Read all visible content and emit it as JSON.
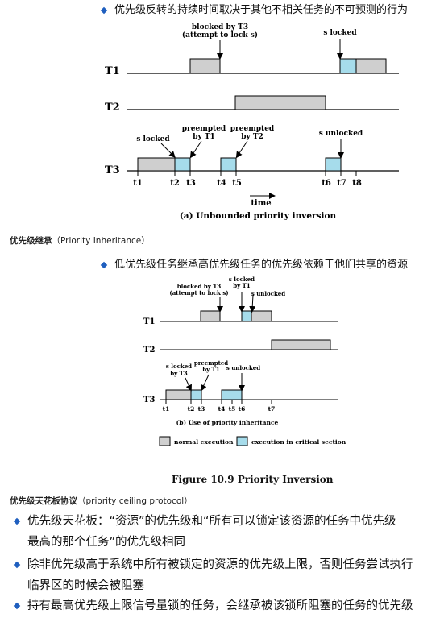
{
  "top_bullet": "优先级反转的持续时间取决于其他不相关任务的不可预测的行为",
  "diagram_a": {
    "rows": [
      "T1",
      "T2",
      "T3"
    ],
    "ann_blocked": [
      "blocked by T3",
      "(attempt to lock s)"
    ],
    "ann_s_locked_t1": "s locked",
    "ann_s_locked_t3": "s locked",
    "ann_preempted_t1": [
      "preempted",
      "by T1"
    ],
    "ann_preempted_t2": [
      "preempted",
      "by T2"
    ],
    "ann_s_unlocked": "s unlocked",
    "ticks": [
      "t1",
      "t2",
      "t3",
      "t4",
      "t5",
      "t6",
      "t7",
      "t8"
    ],
    "time_label": "time",
    "caption": "(a) Unbounded priority inversion"
  },
  "section_inherit": {
    "title": "优先级继承",
    "paren": "（Priority Inheritance）"
  },
  "inherit_bullet": "低优先级任务继承高优先级任务的优先级依赖于他们共享的资源",
  "diagram_b": {
    "rows": [
      "T1",
      "T2",
      "T3"
    ],
    "ann_blocked": [
      "blocked by T3",
      "(attempt to lock s)"
    ],
    "ann_s_locked_by_t1": [
      "s locked",
      "by T1"
    ],
    "ann_s_unlocked_top": "s unlocked",
    "ann_s_locked_by_t3": [
      "s locked",
      "by T3"
    ],
    "ann_preempted": [
      "preempted",
      "by T1"
    ],
    "ann_s_unlocked_bottom": "s unlocked",
    "ticks": [
      "t1",
      "t2",
      "t3",
      "t4",
      "t5",
      "t6",
      "t7"
    ],
    "caption": "(b) Use of priority inheritance",
    "legend": [
      "normal execution",
      "execution in critical section"
    ]
  },
  "figure_caption": "Figure 10.9    Priority Inversion",
  "section_ceiling": {
    "title": "优先级天花板协议",
    "paren": "（priority ceiling protocol）"
  },
  "ceiling_bullets": [
    [
      "优先级天花板：“资源”的优先级和“所有可以锁定该资源的任务中优先级",
      "最高的那个任务”的优先级相同"
    ],
    [
      "除非优先级高于系统中所有被锁定的资源的优先级上限，否则任务尝试执行",
      "临界区的时候会被阻塞"
    ],
    [
      "持有最高优先级上限信号量锁的任务，会继承被该锁所阻塞的任务的优先级"
    ]
  ],
  "colors": {
    "normal": "#cfcfcf",
    "critical": "#a6dceb",
    "bullet": "#1f5fbf"
  }
}
